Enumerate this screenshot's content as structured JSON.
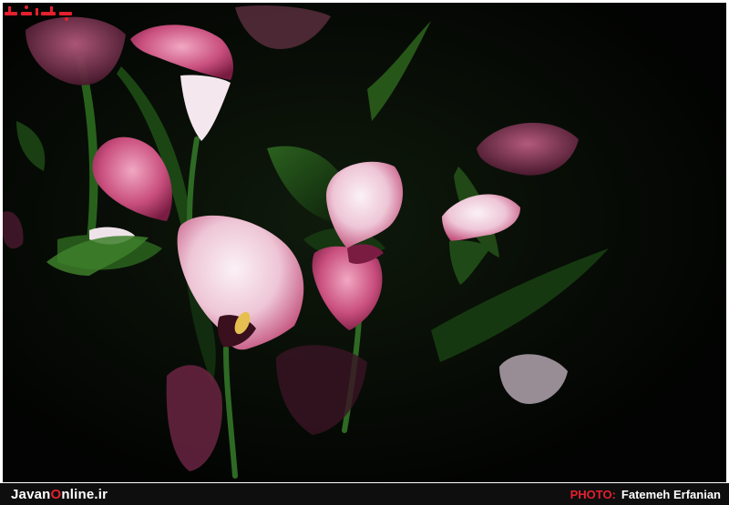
{
  "photo": {
    "subject": "Pink calla lilies against a dark background",
    "watermark_logo": "جوان آنلاین"
  },
  "footer": {
    "site_prefix": "Javan",
    "site_accent": "O",
    "site_suffix": "nline.ir",
    "credit_label": "PHOTO:",
    "credit_name": "Fatemeh Erfanian"
  },
  "colors": {
    "background": "#030503",
    "footer_bar": "#0e0e0e",
    "accent_red": "#e4202e",
    "petal_pink": "#d9678e",
    "petal_white": "#f5e6ee",
    "leaf_green": "#1f4a17"
  }
}
